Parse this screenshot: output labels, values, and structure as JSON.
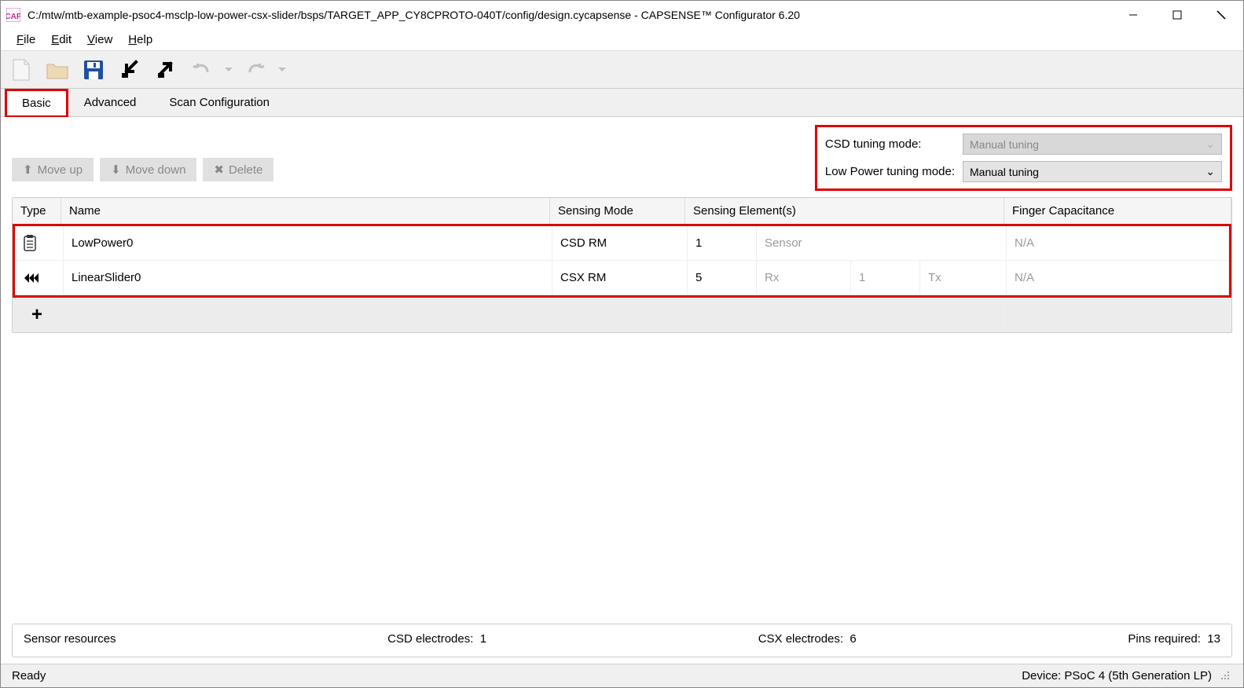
{
  "window": {
    "title": "C:/mtw/mtb-example-psoc4-msclp-low-power-csx-slider/bsps/TARGET_APP_CY8CPROTO-040T/config/design.cycapsense - CAPSENSE™ Configurator 6.20"
  },
  "menu": {
    "file": "File",
    "edit": "Edit",
    "view": "View",
    "help": "Help"
  },
  "tabs": {
    "basic": "Basic",
    "advanced": "Advanced",
    "scan": "Scan Configuration"
  },
  "actions": {
    "moveup": "Move up",
    "movedown": "Move down",
    "delete": "Delete"
  },
  "tuning": {
    "csd_label": "CSD tuning mode:",
    "csd_value": "Manual tuning",
    "lp_label": "Low Power tuning mode:",
    "lp_value": "Manual tuning"
  },
  "headers": {
    "type": "Type",
    "name": "Name",
    "mode": "Sensing Mode",
    "elements": "Sensing Element(s)",
    "cap": "Finger Capacitance"
  },
  "rows": [
    {
      "name": "LowPower0",
      "mode": "CSD RM",
      "e1": "1",
      "e2": "Sensor",
      "e3": "",
      "e4": "",
      "cap": "N/A"
    },
    {
      "name": "LinearSlider0",
      "mode": "CSX RM",
      "e1": "5",
      "e2": "Rx",
      "e3": "1",
      "e4": "Tx",
      "cap": "N/A"
    }
  ],
  "resources": {
    "legend": "Sensor resources",
    "csd_label": "CSD electrodes:",
    "csd_value": "1",
    "csx_label": "CSX electrodes:",
    "csx_value": "6",
    "pins_label": "Pins required:",
    "pins_value": "13"
  },
  "status": {
    "ready": "Ready",
    "device": "Device: PSoC 4 (5th Generation LP)"
  }
}
